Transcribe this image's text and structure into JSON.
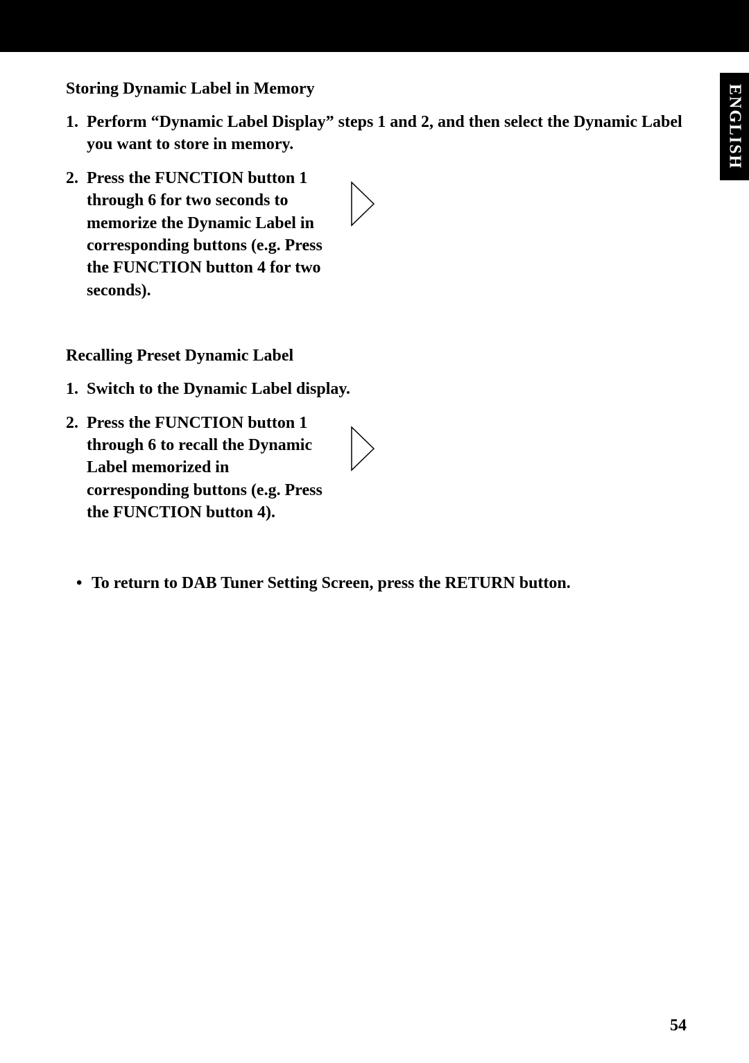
{
  "language_tab": "ENGLISH",
  "page_number": "54",
  "section1": {
    "heading": "Storing Dynamic Label in Memory",
    "step1": {
      "num": "1.",
      "text": "Perform “Dynamic Label Display” steps 1 and 2, and then select the Dynamic Label you want to store in memory."
    },
    "step2": {
      "num": "2.",
      "text": "Press the FUNCTION button 1 through 6 for two seconds to memorize the Dynamic Label in corresponding buttons (e.g. Press the FUNCTION button 4 for two seconds)."
    }
  },
  "section2": {
    "heading": "Recalling Preset Dynamic Label",
    "step1": {
      "num": "1.",
      "text": "Switch to the Dynamic Label display."
    },
    "step2": {
      "num": "2.",
      "text": "Press the FUNCTION button 1 through 6 to recall the Dynamic Label memorized in corresponding buttons (e.g. Press the FUNCTION button 4)."
    }
  },
  "bullet": {
    "dot": "•",
    "text": "To return to DAB Tuner Setting Screen, press the RETURN button."
  }
}
